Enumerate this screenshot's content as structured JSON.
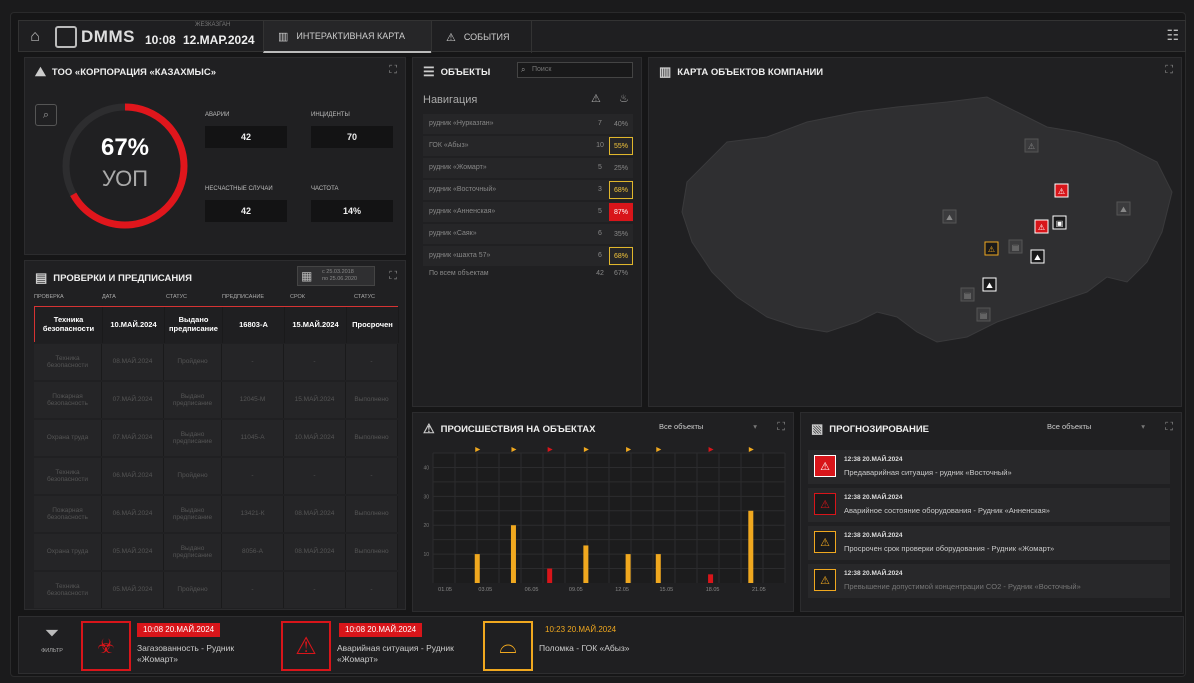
{
  "topbar": {
    "logo": "DMMS",
    "city": "ЖЕЗКАЗГАН",
    "time": "10:08",
    "date": "12.МАР.2024",
    "tabs": [
      {
        "label": "ИНТЕРАКТИВНАЯ КАРТА",
        "active": true
      },
      {
        "label": "СОБЫТИЯ",
        "active": false
      }
    ]
  },
  "company": {
    "title": "ТОО «КОРПОРАЦИЯ «КАЗАХМЫС»",
    "percent": "67%",
    "percent_value": 0.67,
    "percent_label": "УОП",
    "kpis": [
      {
        "label": "АВАРИИ",
        "value": "42"
      },
      {
        "label": "ИНЦИДЕНТЫ",
        "value": "70"
      },
      {
        "label": "НЕСЧАСТНЫЕ СЛУЧАИ",
        "value": "42"
      },
      {
        "label": "ЧАСТОТА",
        "value": "14%"
      }
    ]
  },
  "objects": {
    "title": "ОБЪЕКТЫ",
    "search_placeholder": "Поиск",
    "nav_label": "Навигация",
    "rows": [
      {
        "name": "рудник «Нурказган»",
        "count": "7",
        "pct": "40%",
        "status": "normal"
      },
      {
        "name": "ГОК «Абыз»",
        "count": "10",
        "pct": "55%",
        "status": "warn"
      },
      {
        "name": "рудник «Жомарт»",
        "count": "5",
        "pct": "25%",
        "status": "normal"
      },
      {
        "name": "рудник «Восточный»",
        "count": "3",
        "pct": "68%",
        "status": "warn"
      },
      {
        "name": "рудник «Анненская»",
        "count": "5",
        "pct": "87%",
        "status": "crit"
      },
      {
        "name": "рудник «Саяк»",
        "count": "6",
        "pct": "35%",
        "status": "normal"
      },
      {
        "name": "рудник «шахта 57»",
        "count": "6",
        "pct": "68%",
        "status": "warn"
      }
    ],
    "total": {
      "name": "По всем объектам",
      "count": "42",
      "pct": "67%"
    }
  },
  "map": {
    "title": "КАРТА ОБЪЕКТОВ КОМПАНИИ"
  },
  "inspections": {
    "title": "ПРОВЕРКИ И ПРЕДПИСАНИЯ",
    "date_from": "с 25.03.2018",
    "date_to": "по 25.06.2020",
    "headers": [
      "ПРОВЕРКА",
      "ДАТА",
      "СТАТУС",
      "ПРЕДПИСАНИЕ",
      "СРОК",
      "СТАТУС"
    ],
    "rows": [
      [
        "Техника безопасности",
        "10.МАЙ.2024",
        "Выдано предписание",
        "16803-А",
        "15.МАЙ.2024",
        "Просрочен"
      ],
      [
        "Техника безопасности",
        "08.МАЙ.2024",
        "Пройдено",
        "-",
        "-",
        "-"
      ],
      [
        "Пожарная безопасность",
        "07.МАЙ.2024",
        "Выдано предписание",
        "12045-М",
        "15.МАЙ.2024",
        "Выполнено"
      ],
      [
        "Охрана труда",
        "07.МАЙ.2024",
        "Выдано предписание",
        "11045-А",
        "10.МАЙ.2024",
        "Выполнено"
      ],
      [
        "Техника безопасности",
        "06.МАЙ.2024",
        "Пройдено",
        "-",
        "-",
        "-"
      ],
      [
        "Пожарная безопасность",
        "06.МАЙ.2024",
        "Выдано предписание",
        "13421-К",
        "08.МАЙ.2024",
        "Выполнено"
      ],
      [
        "Охрана труда",
        "05.МАЙ.2024",
        "Выдано предписание",
        "8056-А",
        "08.МАЙ.2024",
        "Выполнено"
      ],
      [
        "Техника безопасности",
        "05.МАЙ.2024",
        "Пройдено",
        "-",
        "-",
        "-"
      ]
    ]
  },
  "incidents": {
    "title": "ПРОИСШЕСТВИЯ НА ОБЪЕКТАХ",
    "filter": "Все объекты"
  },
  "chart_data": {
    "type": "bar",
    "title": "ПРОИСШЕСТВИЯ НА ОБЪЕКТАХ",
    "x_tick_labels": [
      "01.05",
      "03.05",
      "06.05",
      "09.05",
      "12.05",
      "15.05",
      "18.05",
      "21.05"
    ],
    "y_tick_labels": [
      "10",
      "20",
      "30",
      "40"
    ],
    "ylim": [
      0,
      45
    ],
    "grid": true,
    "bars": [
      {
        "x": 2.2,
        "value": 10,
        "color": "#f0a81f"
      },
      {
        "x": 4.0,
        "value": 20,
        "color": "#f0a81f"
      },
      {
        "x": 5.8,
        "value": 5,
        "color": "#d8151a"
      },
      {
        "x": 7.6,
        "value": 13,
        "color": "#f0a81f"
      },
      {
        "x": 9.7,
        "value": 10,
        "color": "#f0a81f"
      },
      {
        "x": 11.2,
        "value": 10,
        "color": "#f0a81f"
      },
      {
        "x": 13.8,
        "value": 3,
        "color": "#d8151a"
      },
      {
        "x": 15.8,
        "value": 25,
        "color": "#f0a81f"
      }
    ],
    "flags": [
      {
        "x": 2.2,
        "color": "#f0a81f"
      },
      {
        "x": 4.0,
        "color": "#f0a81f"
      },
      {
        "x": 5.8,
        "color": "#d8151a"
      },
      {
        "x": 7.6,
        "color": "#f0a81f"
      },
      {
        "x": 9.7,
        "color": "#f0a81f"
      },
      {
        "x": 11.2,
        "color": "#f0a81f"
      },
      {
        "x": 13.8,
        "color": "#d8151a"
      },
      {
        "x": 15.8,
        "color": "#f0a81f"
      }
    ]
  },
  "forecast": {
    "title": "ПРОГНОЗИРОВАНИЕ",
    "filter": "Все объекты",
    "items": [
      {
        "time": "12:38 20.МАЙ.2024",
        "text": "Предаварийная ситуация - рудник «Восточный»",
        "type": "crit"
      },
      {
        "time": "12:38 20.МАЙ.2024",
        "text": "Аварийное состояние оборудования - Рудник «Анненская»",
        "type": "crit-outline"
      },
      {
        "time": "12:38 20.МАЙ.2024",
        "text": "Просрочен срок проверки оборудования - Рудник «Жомарт»",
        "type": "warn"
      },
      {
        "time": "12:38 20.МАЙ.2024",
        "text": "Превышение допустимой концентрации CO2 - Рудник «Восточный»",
        "type": "warn-dim"
      }
    ]
  },
  "bottom": {
    "filter_label": "ФИЛЬТР",
    "alerts": [
      {
        "time": "10:08 20.МАЙ.2024",
        "text": "Загазованность - Рудник «Жомарт»",
        "icon": "gas-icon"
      },
      {
        "time": "10:08 20.МАЙ.2024",
        "text": "Аварийная ситуация - Рудник «Жомарт»",
        "icon": "warning-icon"
      },
      {
        "time": "10:23 20.МАЙ.2024",
        "text": "Поломка - ГОК «Абыз»",
        "icon": "tunnel-icon"
      }
    ]
  },
  "colors": {
    "accent_red": "#d8151a",
    "accent_yellow": "#f0a81f",
    "panel": "#202022"
  }
}
